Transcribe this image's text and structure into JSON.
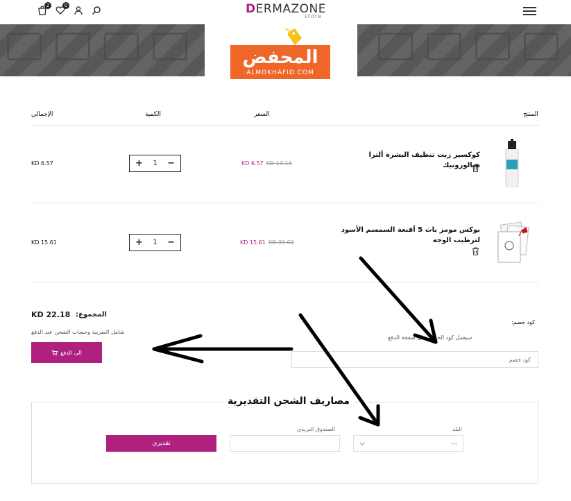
{
  "header": {
    "cart_count": "2",
    "wishlist_count": "0",
    "logo_main": "ERMAZONE",
    "logo_initial": "D",
    "logo_sub": "store"
  },
  "banner": {
    "brand_ar": "المحفض",
    "brand_en": "ALMOKHAFID.COM"
  },
  "table": {
    "headers": {
      "product": "المنتج",
      "price": "السعر",
      "quantity": "الكمية",
      "total": "الإجمالي"
    },
    "rows": [
      {
        "name": "كوكسير زيت تنظيف البشرة ألترا هيالورونيك",
        "price_new": "KD 6.57",
        "price_old": "KD 13.14",
        "qty": "1",
        "total": "KD 6.57"
      },
      {
        "name": "بوكس مومز باث 5 أقنعة السمسم الأسود لترطيب الوجه",
        "price_new": "KD 15.61",
        "price_old": "KD 39.02",
        "qty": "1",
        "total": "KD 15.61"
      }
    ],
    "plus": "+",
    "minus": "−"
  },
  "summary": {
    "label": "المجموع:",
    "value": "KD 22.18",
    "note": "شامل الضريبة وحساب الشحن عند الدفع",
    "checkout": "الى الدفع"
  },
  "coupon": {
    "label": "كود خصم:",
    "note": "سيعمل كود الخصم على صفحة الدفع",
    "placeholder": "كود خصم"
  },
  "shipping": {
    "title": "مصاريف الشحن التقديرية",
    "country_label": "البلد",
    "country_value": "---",
    "postal_label": "الصندوق البريدي",
    "estimate": "تقديري"
  },
  "colors": {
    "accent": "#b0207f",
    "brand_orange": "#ee6628",
    "banner_gray": "#5c5c5c"
  }
}
